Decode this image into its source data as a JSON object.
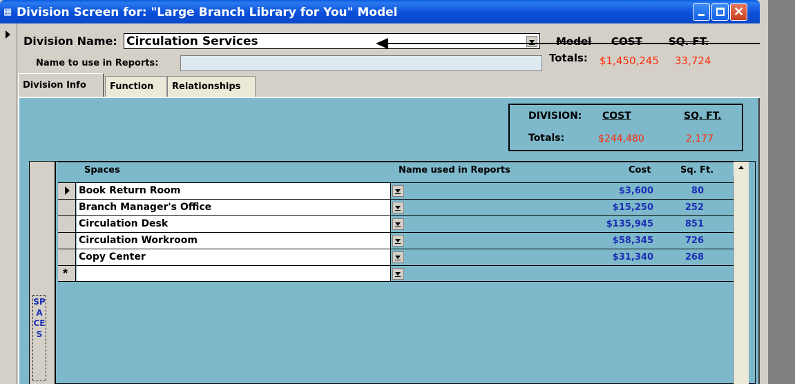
{
  "window": {
    "title": "Division Screen for: \"Large Branch Library for You\" Model",
    "icon": "form-icon",
    "controls": {
      "minimize": "minimize-icon",
      "maximize": "maximize-icon",
      "close": "✕"
    }
  },
  "header": {
    "division_name_label": "Division Name:",
    "division_name_value": "Circulation Services",
    "report_name_label": "Name to use in Reports:",
    "report_name_value": "",
    "model_label": "Model",
    "cost_header": "COST",
    "sqft_header": "SQ. FT.",
    "totals_label": "Totals:",
    "model_cost": "$1,450,245",
    "model_sqft": "33,724"
  },
  "tabs": [
    {
      "label": "Division Info",
      "selected": true
    },
    {
      "label": "Function",
      "selected": false
    },
    {
      "label": "Relationships",
      "selected": false
    }
  ],
  "division_totals": {
    "division_label": "DIVISION:",
    "cost_header": "COST",
    "sqft_header": "SQ. FT.",
    "totals_label": "Totals:",
    "cost": "$244,480",
    "sqft": "2,177"
  },
  "spaces": {
    "side_button": "SPACES",
    "columns": [
      "Spaces",
      "Name used in Reports",
      "Cost",
      "Sq. Ft."
    ],
    "rows": [
      {
        "name": "Book Return Room",
        "report_name": "",
        "cost": "$3,600",
        "sqft": "80"
      },
      {
        "name": "Branch Manager's Office",
        "report_name": "",
        "cost": "$15,250",
        "sqft": "252"
      },
      {
        "name": "Circulation Desk",
        "report_name": "",
        "cost": "$135,945",
        "sqft": "851"
      },
      {
        "name": "Circulation Workroom",
        "report_name": "",
        "cost": "$58,345",
        "sqft": "726"
      },
      {
        "name": "Copy Center",
        "report_name": "",
        "cost": "$31,340",
        "sqft": "268"
      }
    ],
    "new_row_marker": "*"
  },
  "colors": {
    "title_bar": "#0a5ce0",
    "panel": "#7eb9cb",
    "totals_red": "#ff2a0a",
    "value_blue": "#1b2fb3"
  }
}
